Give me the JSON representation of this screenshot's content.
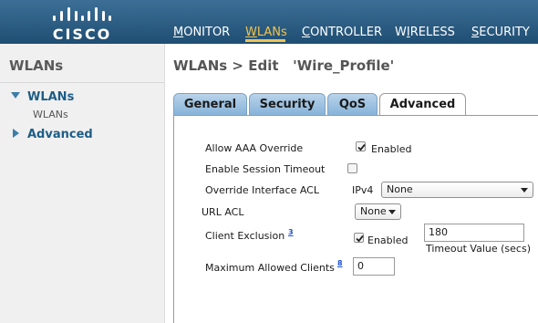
{
  "brand": {
    "name": "CISCO"
  },
  "nav": {
    "items": [
      {
        "label": "MONITOR",
        "active": false
      },
      {
        "label": "WLANs",
        "active": true
      },
      {
        "label": "CONTROLLER",
        "active": false
      },
      {
        "label": "WIRELESS",
        "active": false
      },
      {
        "label": "SECURITY",
        "active": false
      }
    ]
  },
  "sidebar": {
    "title": "WLANs",
    "items": [
      {
        "label": "WLANs",
        "expanded": true,
        "sub": [
          "WLANs"
        ]
      },
      {
        "label": "Advanced",
        "expanded": false
      }
    ]
  },
  "page": {
    "title": "WLANs > Edit   'Wire_Profile'"
  },
  "tabs": [
    {
      "label": "General",
      "active": false
    },
    {
      "label": "Security",
      "active": false
    },
    {
      "label": "QoS",
      "active": false
    },
    {
      "label": "Advanced",
      "active": true
    }
  ],
  "advanced": {
    "allow_aaa_override": {
      "label": "Allow AAA Override",
      "checked": true,
      "suffix": "Enabled"
    },
    "enable_session_timeout": {
      "label": "Enable Session Timeout",
      "checked": false
    },
    "override_interface_acl": {
      "label": "Override Interface ACL",
      "prefix": "IPv4",
      "value": "None"
    },
    "url_acl": {
      "label": "URL ACL",
      "value": "None"
    },
    "client_exclusion": {
      "label": "Client Exclusion",
      "footnote": "3",
      "checked": true,
      "suffix": "Enabled",
      "timeout_value": "180",
      "timeout_label": "Timeout Value (secs)"
    },
    "max_allowed_clients": {
      "label": "Maximum Allowed Clients",
      "footnote": "8",
      "value": "0"
    }
  },
  "colors": {
    "header": "#2a5c84",
    "accent": "#f2c34e",
    "tab": "#9cc2e5",
    "link": "#1d5d86"
  }
}
